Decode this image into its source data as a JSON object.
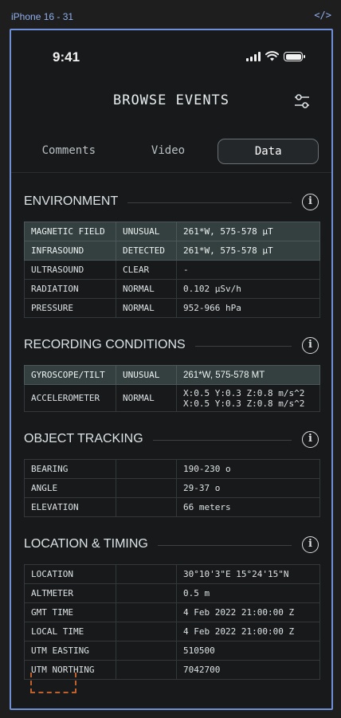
{
  "figma": {
    "frame_label": "iPhone 16 - 31",
    "code_glyph": "</>"
  },
  "status_bar": {
    "time": "9:41"
  },
  "header": {
    "title": "BROWSE EVENTS"
  },
  "tabs": [
    {
      "label": "Comments"
    },
    {
      "label": "Video"
    },
    {
      "label": "Data",
      "active": true
    }
  ],
  "environment": {
    "title": "ENVIRONMENT",
    "rows": [
      {
        "name": "MAGNETIC FIELD",
        "status": "UNUSUAL",
        "value": "261*W, 575-578 µT",
        "highlight": true
      },
      {
        "name": "INFRASOUND",
        "status": "DETECTED",
        "value": "261*W, 575-578 µT",
        "highlight": true
      },
      {
        "name": "ULTRASOUND",
        "status": "CLEAR",
        "value": "-"
      },
      {
        "name": "RADIATION",
        "status": "NORMAL",
        "value": "0.102 µSv/h"
      },
      {
        "name": "PRESSURE",
        "status": "NORMAL",
        "value": "952-966 hPa"
      }
    ]
  },
  "recording": {
    "title": "RECORDING CONDITIONS",
    "rows": [
      {
        "name": "GYROSCOPE/TILT",
        "status": "UNUSUAL",
        "value": "261*W, 575-578 MT",
        "highlight": true
      },
      {
        "name": "ACCELEROMETER",
        "status": "NORMAL",
        "value_line1": "X:0.5 Y:0.3 Z:0.8 m/s^2",
        "value_line2": "X:0.5 Y:0.3 Z:0.8 m/s^2"
      }
    ]
  },
  "tracking": {
    "title": "OBJECT TRACKING",
    "rows": [
      {
        "name": "BEARING",
        "status": "",
        "value": "190-230 o"
      },
      {
        "name": "ANGLE",
        "status": "",
        "value": "29-37 o"
      },
      {
        "name": "ELEVATION",
        "status": "",
        "value": "66 meters"
      }
    ]
  },
  "location": {
    "title": "LOCATION & TIMING",
    "rows": [
      {
        "name": "LOCATION",
        "status": "",
        "value": "30°10'3\"E  15°24'15\"N"
      },
      {
        "name": "ALTMETER",
        "status": "",
        "value": "0.5 m"
      },
      {
        "name": "GMT TIME",
        "status": "",
        "value": "4 Feb 2022  21:00:00 Z"
      },
      {
        "name": "LOCAL TIME",
        "status": "",
        "value": "4 Feb 2022  21:00:00 Z"
      },
      {
        "name": "UTM EASTING",
        "status": "",
        "value": "510500"
      },
      {
        "name": "UTM NORTHING",
        "status": "",
        "value": "7042700"
      }
    ]
  },
  "icons": {
    "filter": "sliders-icon",
    "info": "info-icon",
    "signal": "cellular-signal-icon",
    "wifi": "wifi-icon",
    "battery": "battery-icon"
  },
  "info_glyph": "i"
}
